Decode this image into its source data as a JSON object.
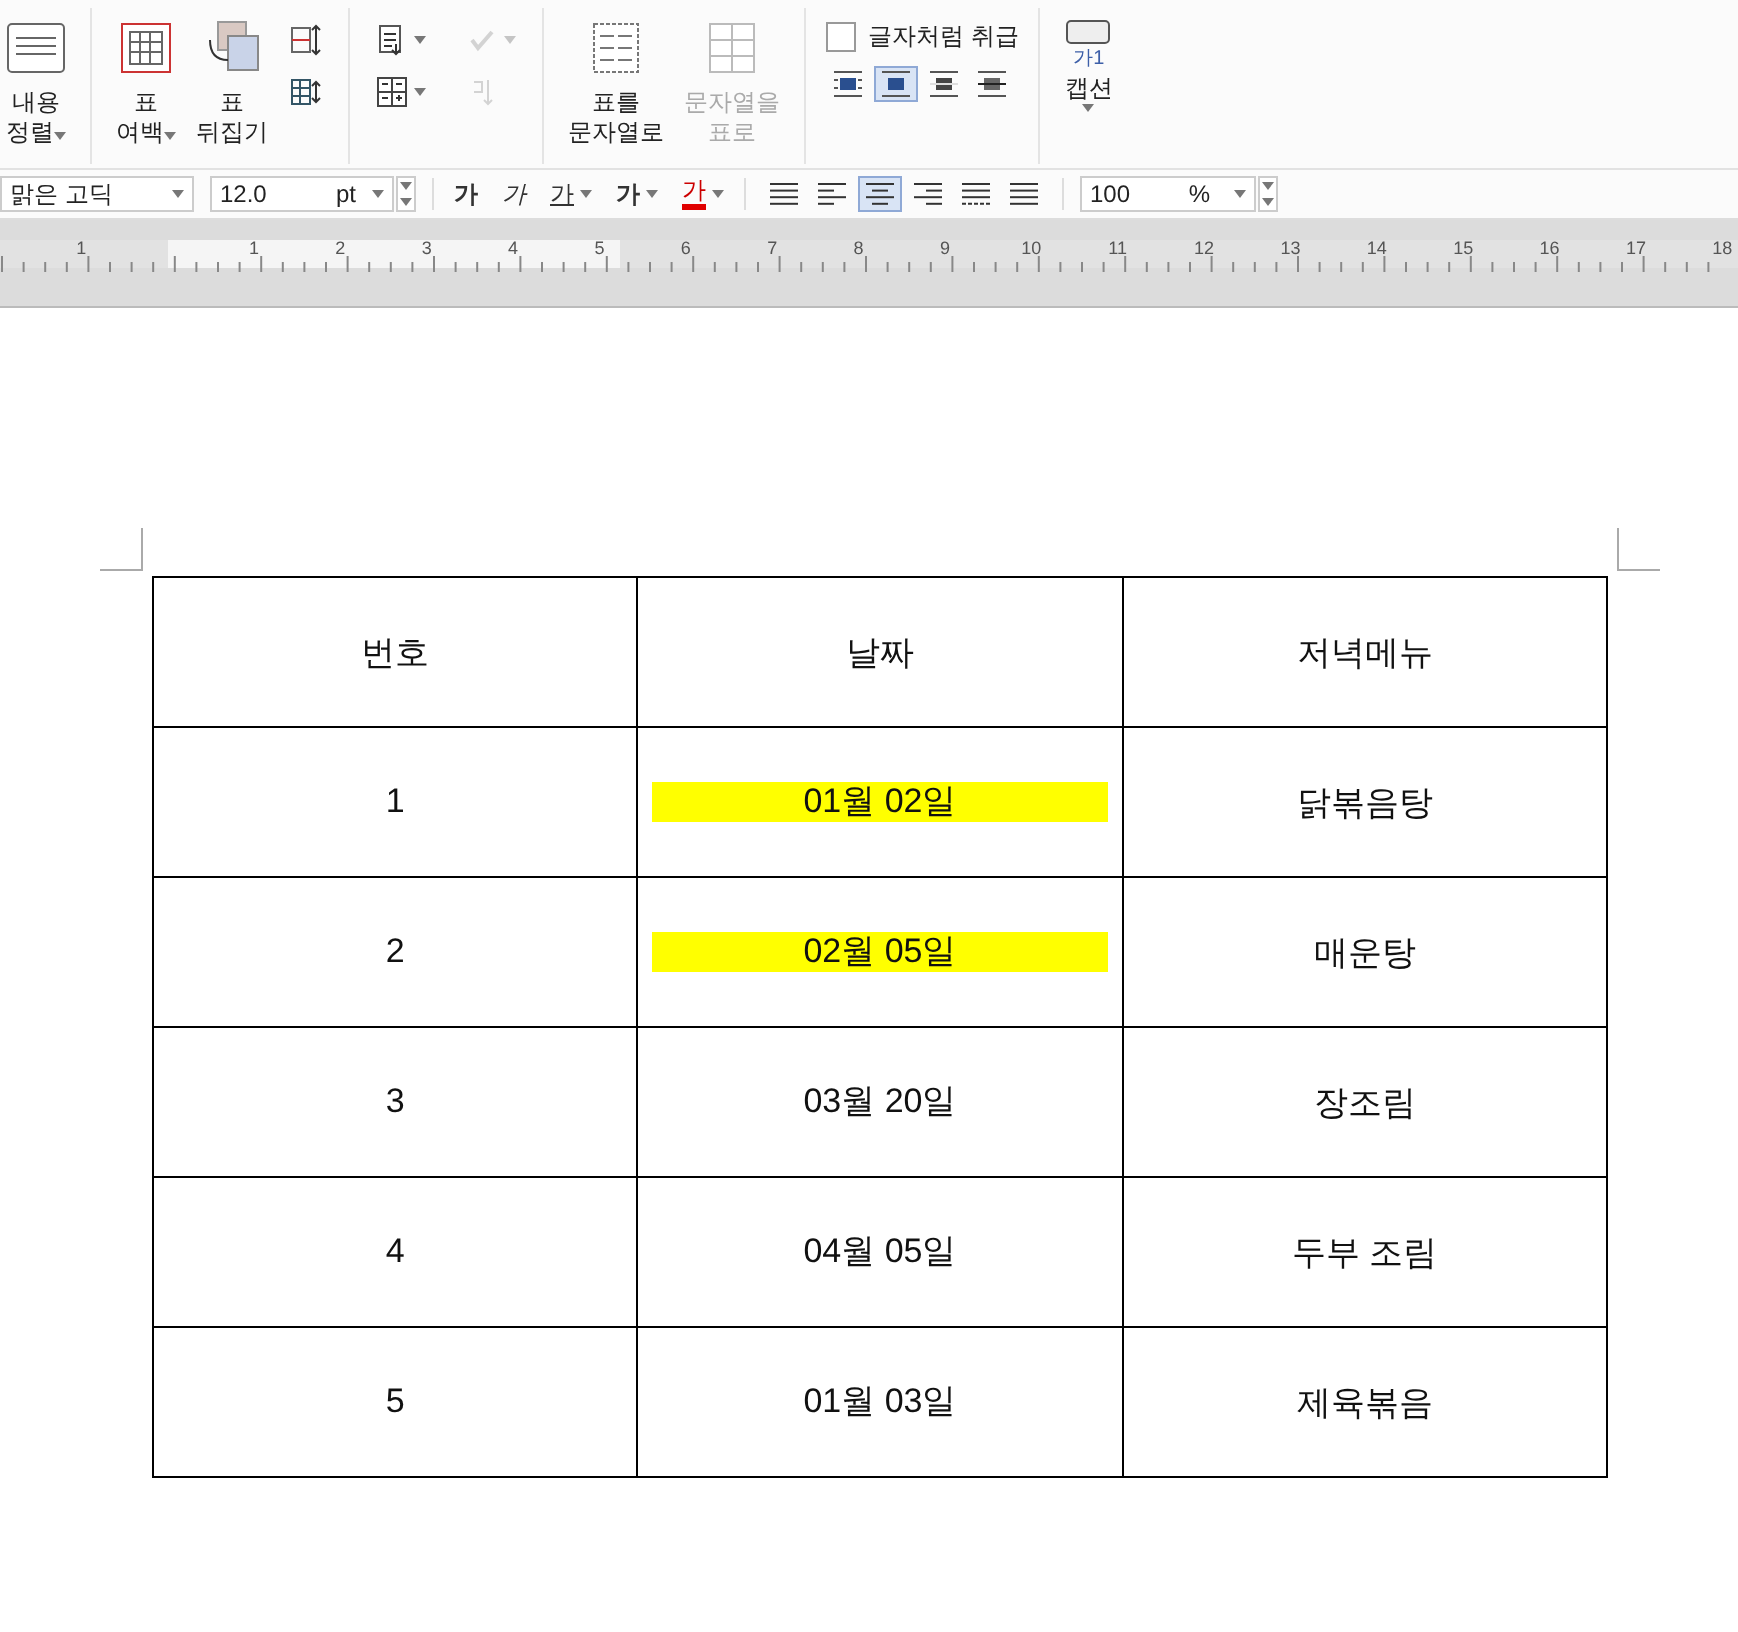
{
  "ribbon": {
    "groups": [
      {
        "kind": "big",
        "buttons": [
          {
            "kind": "align",
            "lines": [
              "내용",
              "정렬"
            ],
            "caret": true,
            "disabled": false
          }
        ]
      },
      {
        "kind": "big",
        "buttons": [
          {
            "kind": "margin",
            "lines": [
              "표",
              "여백"
            ],
            "caret": true,
            "disabled": false
          },
          {
            "kind": "flip",
            "lines": [
              "표",
              "뒤집기"
            ],
            "caret": false,
            "disabled": false
          }
        ],
        "smalls": [
          {
            "kind": "rowheight",
            "caret": false,
            "disabled": false
          },
          {
            "kind": "colwidth",
            "caret": false,
            "disabled": false
          }
        ]
      },
      {
        "kind": "smalls",
        "smalls": [
          {
            "kind": "insert",
            "caret": true,
            "disabled": false
          },
          {
            "kind": "calc",
            "caret": true,
            "disabled": false
          }
        ],
        "smalls2": [
          {
            "kind": "number",
            "caret": true,
            "disabled": true
          },
          {
            "kind": "sort",
            "caret": false,
            "disabled": true
          }
        ]
      },
      {
        "kind": "big",
        "buttons": [
          {
            "kind": "totext",
            "lines": [
              "표를",
              "문자열로"
            ],
            "caret": false,
            "disabled": false
          },
          {
            "kind": "totable",
            "lines": [
              "문자열을",
              "표로"
            ],
            "caret": false,
            "disabled": true
          }
        ]
      },
      {
        "kind": "wrap",
        "checkbox": {
          "label": "글자처럼 취급",
          "checked": false
        },
        "wraps": [
          {
            "kind": "square",
            "selected": false
          },
          {
            "kind": "topbottom",
            "selected": true
          },
          {
            "kind": "front",
            "selected": false
          },
          {
            "kind": "behind",
            "selected": false
          }
        ]
      },
      {
        "kind": "caption",
        "icon_text": "가1",
        "label": "캡션",
        "caret": true
      }
    ]
  },
  "format_bar": {
    "font": "맑은 고딕",
    "size": "12.0",
    "unit": "pt",
    "styles": [
      {
        "kind": "bold",
        "glyph": "가",
        "caret": false
      },
      {
        "kind": "italic",
        "glyph": "가",
        "caret": false
      },
      {
        "kind": "underline",
        "glyph": "가",
        "caret": true
      },
      {
        "kind": "strike",
        "glyph": "가",
        "caret": true
      },
      {
        "kind": "color",
        "glyph": "가",
        "caret": true
      }
    ],
    "aligns": [
      {
        "kind": "justify",
        "selected": false
      },
      {
        "kind": "left",
        "selected": false
      },
      {
        "kind": "center",
        "selected": true
      },
      {
        "kind": "right",
        "selected": false
      },
      {
        "kind": "distribute",
        "selected": false
      },
      {
        "kind": "split",
        "selected": false
      }
    ],
    "zoom": "100",
    "zoom_unit": "%"
  },
  "ruler": {
    "left_labels": [
      "1"
    ],
    "labels": [
      "1",
      "2",
      "3",
      "4",
      "5",
      "6",
      "7",
      "8",
      "9",
      "10",
      "11",
      "12",
      "13",
      "14",
      "15",
      "16",
      "17",
      "18"
    ]
  },
  "table": {
    "columns": [
      "번호",
      "날짜",
      "저녁메뉴"
    ],
    "rows": [
      {
        "cells": [
          "1",
          "01월 02일",
          "닭볶음탕"
        ],
        "highlighted": true
      },
      {
        "cells": [
          "2",
          "02월 05일",
          "매운탕"
        ],
        "highlighted": true
      },
      {
        "cells": [
          "3",
          "03월 20일",
          "장조림"
        ],
        "highlighted": false
      },
      {
        "cells": [
          "4",
          "04월 05일",
          "두부 조림"
        ],
        "highlighted": false
      },
      {
        "cells": [
          "5",
          "01월 03일",
          "제육볶음"
        ],
        "highlighted": false
      }
    ]
  }
}
